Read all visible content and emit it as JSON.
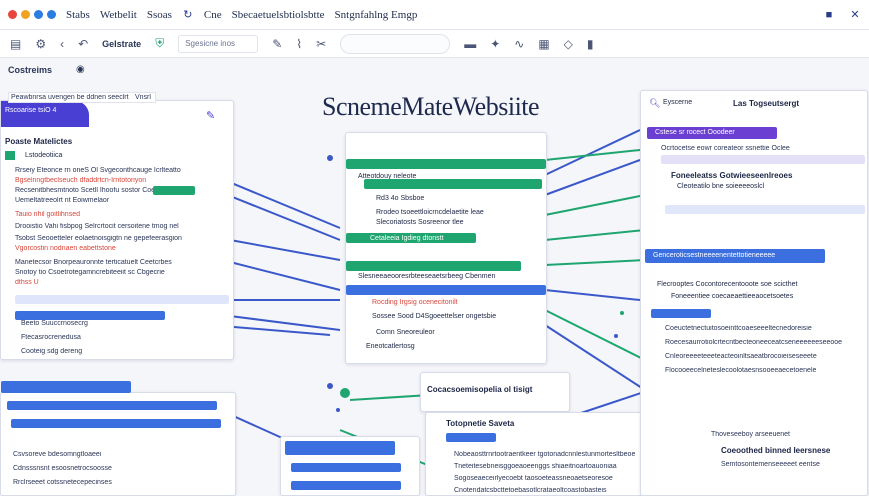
{
  "titlebar": {
    "menu": [
      "Stabs",
      "Wetbelit",
      "Ssoas",
      "Cne",
      "Sbecaetuelsbtiolsbtte",
      "Sntgnfahlng Emgp"
    ],
    "dot_colors": [
      "#e8453c",
      "#f0a323",
      "#2a7de1",
      "#2a7de1"
    ]
  },
  "toolbar": {
    "breadcrumb_label": "Gelstrate",
    "field_text": "Sgesicne inos"
  },
  "subrow": {
    "label": "Costreims"
  },
  "main": {
    "title": "ScnemeMateWebsiite"
  },
  "left_panel": {
    "header_label": "Rscoarise tsiO 4",
    "header_bar_text": "Peawbnrsa uvengen be ddnen seeclrt",
    "header_search": "Vnsrl",
    "title": "Poaste Matelictes",
    "tab": "Lstodeotiica",
    "rows": [
      "Rrseiy Eteonce rn oneS Ol Svgeconthcauge Icrlteatto",
      "Bgselnngtbeclseuch dfaddrtcn-Irntotoriyon",
      "Recsenitbhesmtnoto Scetll Ihoofu sostor Coeedlbe",
      "Uemeltatreeolrt nt Eoiwmelaor",
      "Tauio nhil goitlihnsed",
      "Drooistio Vahi fisbpog Selrcrtocit cersoitene tmog nel",
      "Tsobst Seooetteler eolaetnoisgigtn ne gepefeerasgion",
      "Vgorcostin nodnaen eabettstone",
      "Manetecsor Bnorpeauronnte terticatuelt Ceetcrbes",
      "Snotoy tio Csoetrotegamncrebiteeiit sc Cbgecrie",
      "dthss U"
    ],
    "sub_rows": [
      "Beeto Suuccrnosecrg",
      "Ftecasrocrenedusa",
      "Cooteig sdg dereng"
    ]
  },
  "center_nodes": {
    "n1": "Atteotdouy neleote",
    "n2": "Rd3 4o Sbsboe",
    "n3": "Rrodeo tsoeettloicrncdelaetite leae",
    "n4": "Slecoriatosts Sosreenor tlee",
    "n5": "Cetaleeia Igdieg dtonstt",
    "n6": "Slesneeaeooresrbteeseaetsrbeeg Cbenmen",
    "n7": "Rocding Irgsig ocenecitonilt",
    "n8": "Sossee Sood D4Sgoeettelser ongetsbie",
    "n9": "Comn Sneoreuleor",
    "n10": "Eneotcatlertosg"
  },
  "bottom_center": {
    "title": "Cocacsoemisopelia ol tisigt",
    "pill": "Totopnetie Saveta",
    "rows": [
      "Nobeaosttrnrtootraentkeer tgotonadcnnlestunmortesltbeoe",
      "Tneteitesebneisggoeaoeenggs shiaeitnoartoauoniaa",
      "Sogoseaeceirlyecoebt taosoeteassneoaetseoresoe",
      "Cnotendatcsbcttetoebasotlcrataeoltcoastobasteis"
    ]
  },
  "right_panel": {
    "search_label": "Eyscerne",
    "title": "Las Togseutsergt",
    "header_bar": "Cstese sr rocect Ooodeer",
    "row1": "Ocrtocetse eowr coreateor ssnettie Oclee",
    "node_title": "Foneeleatss Gotwieeseenlreoes",
    "node_sub": "Cleoteatilo bne soieeeeoslcl",
    "section2": "Genceroticsestneeeenentettotieneeeee",
    "section2_sub": "Flecrooptes Cocontorecentooote soe scicthet",
    "section2_sub2": "Foneeentiee coecaeaettieeaocetsoetes",
    "rows": [
      "Coeuctetnectuitosoeinttcoaeseeeltecnedoreisie",
      "Roecesaurrotiolcrtecntbecteoneeceatcseneeeeeeseeooe",
      "Cnleoreeeeteeeteacteoinltsaeatbrocoieiseseeete",
      "Flocooeecelneteslecoolotaesnsooeeaecetoenele"
    ],
    "footer_a": "Thoveseeboy arseeuenet",
    "footer_b": "Coeoothed binned Ieersnese",
    "footer_c": "Semtosontemenseeeeet eentse"
  },
  "bottom_left": {
    "rows": [
      "Csvsoreve bdesomngtloaeei",
      "Cdnsssnsnt esoosnetrocsoosse",
      "Rrclrseeet cotssnetecepecinses"
    ]
  }
}
